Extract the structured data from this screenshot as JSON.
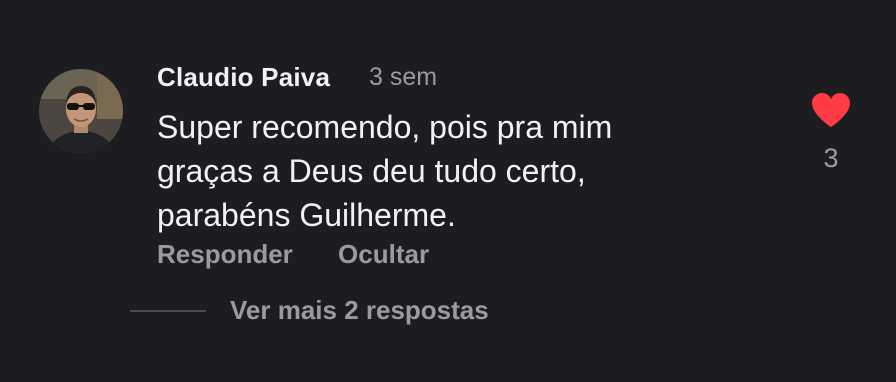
{
  "comment": {
    "author": "Claudio Paiva",
    "time": "3 sem",
    "text_lines": [
      "Super recomendo, pois pra mim",
      "graças a Deus deu tudo certo,",
      "parabéns Guilherme."
    ],
    "like_count": "3",
    "liked": true,
    "like_color": "#ff3b46"
  },
  "actions": {
    "reply": "Responder",
    "hide": "Ocultar"
  },
  "replies": {
    "label": "Ver mais 2 respostas"
  },
  "icons": {
    "like": "heart-icon"
  }
}
